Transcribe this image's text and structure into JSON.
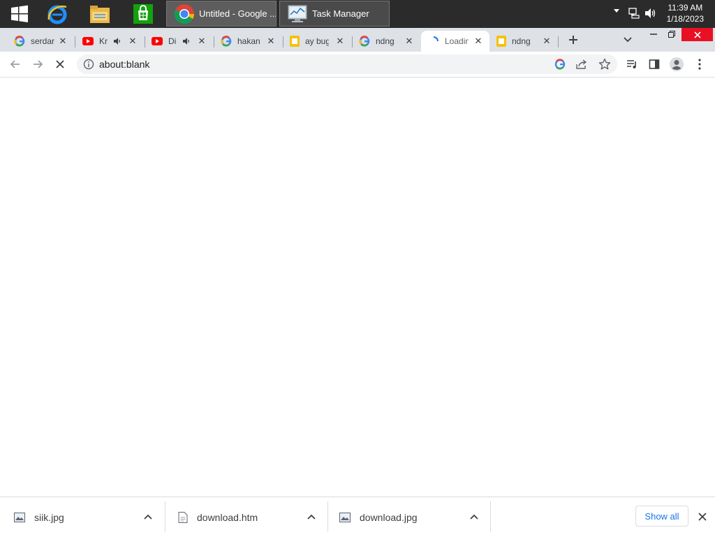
{
  "taskbar": {
    "buttons": [
      {
        "label": "Untitled - Google ..."
      },
      {
        "label": "Task Manager"
      }
    ],
    "clock": {
      "time": "11:39 AM",
      "date": "1/18/2023"
    }
  },
  "tabs": [
    {
      "label": "serdar"
    },
    {
      "label": "Kr"
    },
    {
      "label": "Di"
    },
    {
      "label": "hakan"
    },
    {
      "label": "ay bug"
    },
    {
      "label": "ndng"
    },
    {
      "label": "Loadin"
    },
    {
      "label": "ndng"
    }
  ],
  "toolbar": {
    "url": "about:blank"
  },
  "downloads": {
    "items": [
      {
        "name": "siik.jpg"
      },
      {
        "name": "download.htm"
      },
      {
        "name": "download.jpg"
      }
    ],
    "show_all": "Show all"
  },
  "colors": {
    "taskbar": "#2b2b2b",
    "tabstrip": "#dee1e6",
    "accent": "#1a73e8"
  }
}
